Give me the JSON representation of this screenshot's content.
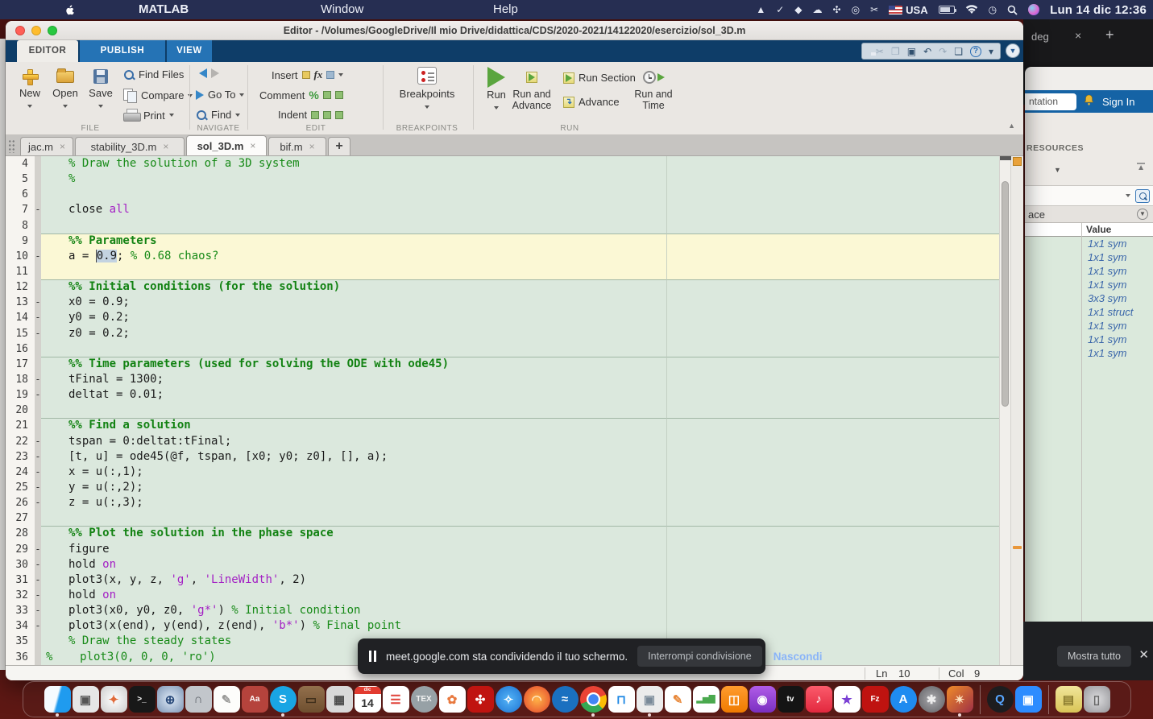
{
  "menubar": {
    "app": "MATLAB",
    "window": "Window",
    "help": "Help",
    "clock": "Lun 14 dic 12:36",
    "flag_label": "USA",
    "status_icons": [
      {
        "name": "shape-app-icon",
        "type": "glyph",
        "glyph": "▲"
      },
      {
        "name": "checkmark-app-icon",
        "type": "glyph",
        "glyph": "✓"
      },
      {
        "name": "dropbox-icon",
        "type": "glyph",
        "glyph": "◆"
      },
      {
        "name": "cloud-upload-icon",
        "type": "glyph",
        "glyph": "☁"
      },
      {
        "name": "fan-app-icon",
        "type": "glyph",
        "glyph": "✣"
      },
      {
        "name": "screen-record-icon",
        "type": "glyph",
        "glyph": "◎"
      },
      {
        "name": "scissors-icon",
        "type": "glyph",
        "glyph": "✂"
      },
      {
        "name": "flag-usa-icon",
        "type": "flag"
      },
      {
        "name": "battery-icon",
        "type": "battery"
      },
      {
        "name": "wifi-icon",
        "type": "wifi"
      },
      {
        "name": "time-machine-icon",
        "type": "glyph",
        "glyph": "◷"
      },
      {
        "name": "spotlight-icon",
        "type": "search"
      },
      {
        "name": "siri-icon",
        "type": "siri"
      }
    ]
  },
  "win": {
    "title": "Editor - /Volumes/GoogleDrive/Il mio Drive/didattica/CDS/2020-2021/14122020/esercizio/sol_3D.m"
  },
  "qat": [
    {
      "name": "save-icon",
      "kind": "floppy"
    },
    {
      "name": "cut-icon",
      "glyph": "✂",
      "disabled": true
    },
    {
      "name": "copy-icon",
      "glyph": "❐",
      "disabled": true
    },
    {
      "name": "paste-icon",
      "glyph": "▣"
    },
    {
      "name": "undo-icon",
      "glyph": "↶"
    },
    {
      "name": "redo-icon",
      "glyph": "↷",
      "disabled": true
    },
    {
      "name": "switch-window-icon",
      "glyph": "❏"
    },
    {
      "name": "help-icon",
      "kind": "help",
      "glyph": "?"
    },
    {
      "name": "more-commands-icon",
      "glyph": "▾"
    }
  ],
  "ribbon": {
    "tabs": [
      "EDITOR",
      "PUBLISH",
      "VIEW"
    ],
    "file": {
      "group": "FILE",
      "new": "New",
      "open": "Open",
      "save": "Save",
      "find_files": "Find Files",
      "compare": "Compare",
      "print": "Print"
    },
    "navigate": {
      "group": "NAVIGATE",
      "goto": "Go To",
      "find": "Find"
    },
    "edit": {
      "group": "EDIT",
      "insert": "Insert",
      "comment": "Comment",
      "indent": "Indent"
    },
    "breakpoints": {
      "group": "BREAKPOINTS",
      "button": "Breakpoints"
    },
    "run": {
      "group": "RUN",
      "run": "Run",
      "run_advance": "Run and Advance",
      "run_section": "Run Section",
      "advance": "Advance",
      "run_time": "Run and Time"
    }
  },
  "file_tabs": {
    "close_glyph": "×",
    "new_tab": "+",
    "tabs": [
      {
        "label": "jac.m",
        "active": false
      },
      {
        "label": "stability_3D.m",
        "active": false
      },
      {
        "label": "sol_3D.m",
        "active": true
      },
      {
        "label": "bif.m",
        "active": false
      }
    ]
  },
  "editor": {
    "lines": [
      {
        "n": 4,
        "bg": "g",
        "seg": [
          [
            "c",
            "% Draw the solution of a 3D system"
          ]
        ]
      },
      {
        "n": 5,
        "bg": "g",
        "seg": [
          [
            "c",
            "%"
          ]
        ]
      },
      {
        "n": 6,
        "bg": "g",
        "seg": []
      },
      {
        "n": 7,
        "bg": "g",
        "d": true,
        "seg": [
          [
            "t",
            "close "
          ],
          [
            "p",
            "all"
          ]
        ]
      },
      {
        "n": 8,
        "bg": "g",
        "seg": []
      },
      {
        "n": 9,
        "bg": "y",
        "div": true,
        "seg": [
          [
            "s",
            "%% Parameters"
          ]
        ]
      },
      {
        "n": 10,
        "bg": "y",
        "d": true,
        "seg": [
          [
            "t",
            "a = "
          ],
          [
            "x",
            "0.9"
          ],
          [
            "t",
            "; "
          ],
          [
            "c",
            "% 0.68 chaos?"
          ]
        ]
      },
      {
        "n": 11,
        "bg": "y",
        "seg": []
      },
      {
        "n": 12,
        "bg": "g",
        "div": true,
        "seg": [
          [
            "s",
            "%% Initial conditions (for the solution)"
          ]
        ]
      },
      {
        "n": 13,
        "bg": "g",
        "d": true,
        "seg": [
          [
            "t",
            "x0 = 0.9;"
          ]
        ]
      },
      {
        "n": 14,
        "bg": "g",
        "d": true,
        "seg": [
          [
            "t",
            "y0 = 0.2;"
          ]
        ]
      },
      {
        "n": 15,
        "bg": "g",
        "d": true,
        "seg": [
          [
            "t",
            "z0 = 0.2;"
          ]
        ]
      },
      {
        "n": 16,
        "bg": "g",
        "seg": []
      },
      {
        "n": 17,
        "bg": "g",
        "div": true,
        "seg": [
          [
            "s",
            "%% Time parameters (used for solving the ODE with ode45)"
          ]
        ]
      },
      {
        "n": 18,
        "bg": "g",
        "d": true,
        "seg": [
          [
            "t",
            "tFinal = 1300;"
          ]
        ]
      },
      {
        "n": 19,
        "bg": "g",
        "d": true,
        "seg": [
          [
            "t",
            "deltat = 0.01;"
          ]
        ]
      },
      {
        "n": 20,
        "bg": "g",
        "seg": []
      },
      {
        "n": 21,
        "bg": "g",
        "div": true,
        "seg": [
          [
            "s",
            "%% Find a solution"
          ]
        ]
      },
      {
        "n": 22,
        "bg": "g",
        "d": true,
        "seg": [
          [
            "t",
            "tspan = 0:deltat:tFinal;"
          ]
        ]
      },
      {
        "n": 23,
        "bg": "g",
        "d": true,
        "seg": [
          [
            "t",
            "[t, u] = ode45(@f, tspan, [x0; y0; z0], [], a);"
          ]
        ]
      },
      {
        "n": 24,
        "bg": "g",
        "d": true,
        "seg": [
          [
            "t",
            "x = u(:,1);"
          ]
        ]
      },
      {
        "n": 25,
        "bg": "g",
        "d": true,
        "seg": [
          [
            "t",
            "y = u(:,2);"
          ]
        ]
      },
      {
        "n": 26,
        "bg": "g",
        "d": true,
        "seg": [
          [
            "t",
            "z = u(:,3);"
          ]
        ]
      },
      {
        "n": 27,
        "bg": "g",
        "seg": []
      },
      {
        "n": 28,
        "bg": "g",
        "div": true,
        "seg": [
          [
            "s",
            "%% Plot the solution in the phase space"
          ]
        ]
      },
      {
        "n": 29,
        "bg": "g",
        "d": true,
        "seg": [
          [
            "t",
            "figure"
          ]
        ]
      },
      {
        "n": 30,
        "bg": "g",
        "d": true,
        "seg": [
          [
            "t",
            "hold "
          ],
          [
            "p",
            "on"
          ]
        ]
      },
      {
        "n": 31,
        "bg": "g",
        "d": true,
        "seg": [
          [
            "t",
            "plot3(x, y, z, "
          ],
          [
            "p",
            "'g'"
          ],
          [
            "t",
            ", "
          ],
          [
            "p",
            "'LineWidth'"
          ],
          [
            "t",
            ", 2)"
          ]
        ]
      },
      {
        "n": 32,
        "bg": "g",
        "d": true,
        "seg": [
          [
            "t",
            "hold "
          ],
          [
            "p",
            "on"
          ]
        ]
      },
      {
        "n": 33,
        "bg": "g",
        "d": true,
        "seg": [
          [
            "t",
            "plot3(x0, y0, z0, "
          ],
          [
            "p",
            "'g*'"
          ],
          [
            "t",
            ") "
          ],
          [
            "c",
            "% Initial condition"
          ]
        ]
      },
      {
        "n": 34,
        "bg": "g",
        "d": true,
        "seg": [
          [
            "t",
            "plot3(x(end), y(end), z(end), "
          ],
          [
            "p",
            "'b*'"
          ],
          [
            "t",
            ") "
          ],
          [
            "c",
            "% Final point"
          ]
        ]
      },
      {
        "n": 35,
        "bg": "g",
        "seg": [
          [
            "c",
            "% Draw the steady states"
          ]
        ]
      },
      {
        "n": 36,
        "bg": "g",
        "ind": 6,
        "seg": [
          [
            "c",
            "%    plot3(0, 0, 0, 'ro')"
          ]
        ]
      }
    ]
  },
  "statusbar": {
    "ln_label": "Ln",
    "ln_value": "10",
    "col_label": "Col",
    "col_value": "9"
  },
  "rightpanel": {
    "browser_tab": "deg",
    "browser_close": "×",
    "browser_new": "+",
    "search_value": "ntation",
    "sign_in": "Sign In",
    "resources": "RESOURCES",
    "workspace_title": "ace",
    "value_header": "Value",
    "values": [
      "1x1 sym",
      "1x1 sym",
      "1x1 sym",
      "1x1 sym",
      "3x3 sym",
      "1x1 struct",
      "1x1 sym",
      "1x1 sym",
      "1x1 sym"
    ]
  },
  "meet": {
    "message": "meet.google.com sta condividendo il tuo schermo.",
    "stop_button": "Interrompi condivisione",
    "hide_button": "Nascondi",
    "show_all_button": "Mostra tutto",
    "close_glyph": "✕"
  },
  "dock": {
    "items": [
      {
        "name": "finder",
        "bg": "linear-gradient(105deg,#f5fbff 46%,#1f9bef 54%)",
        "glyph": "",
        "running": true
      },
      {
        "name": "screenshot",
        "bg": "#e6e6e6",
        "glyph": "▣",
        "color": "#555"
      },
      {
        "name": "launchpad",
        "bg": "radial-gradient(circle,#ffffff,#cccccc)",
        "glyph": "✦",
        "color": "#e06a3a"
      },
      {
        "name": "terminal",
        "bg": "#181818",
        "glyph": ">_",
        "color": "#ffffff",
        "small": true
      },
      {
        "name": "html-editor",
        "bg": "radial-gradient(circle,#dfeaf7,#7d95b5)",
        "glyph": "⊕",
        "color": "#2a4a7a"
      },
      {
        "name": "archive-utility",
        "bg": "#c2c6cb",
        "glyph": "∩",
        "color": "#5a5f66"
      },
      {
        "name": "textedit",
        "bg": "#fdfdfb",
        "glyph": "✎",
        "color": "#9a9a98"
      },
      {
        "name": "dictionary",
        "bg": "#b5433c",
        "glyph": "Aa",
        "color": "#ffffff",
        "small": true
      },
      {
        "name": "skype",
        "bg": "#19a5e4",
        "glyph": "S",
        "color": "#ffffff",
        "shape": "circle",
        "running": true
      },
      {
        "name": "photo-booth",
        "bg": "linear-gradient(#93704c,#6e4f2f)",
        "glyph": "▭",
        "color": "#41301c"
      },
      {
        "name": "calculator",
        "bg": "#d9d9d9",
        "glyph": "▦",
        "color": "#4a4a4a"
      },
      {
        "name": "calendar",
        "type": "cal",
        "top": "dic",
        "day": "14"
      },
      {
        "name": "reminders",
        "bg": "#ffffff",
        "glyph": "☰",
        "color": "#e0443a"
      },
      {
        "name": "texshop",
        "bg": "#97a1a6",
        "glyph": "TEX",
        "color": "#f2f2f2",
        "shape": "circle",
        "small": true
      },
      {
        "name": "photos",
        "bg": "#ffffff",
        "glyph": "✿",
        "color": "#e8793f"
      },
      {
        "name": "acrobat",
        "bg": "#c01410",
        "glyph": "✣",
        "color": "#ffffff"
      },
      {
        "name": "safari",
        "bg": "radial-gradient(circle,#55b5f7,#1c72d2)",
        "glyph": "✧",
        "color": "#ffffff",
        "shape": "circle"
      },
      {
        "name": "firefox",
        "bg": "radial-gradient(circle,#ffb347,#e3432c)",
        "glyph": "◠",
        "color": "#ffe9c2",
        "shape": "circle"
      },
      {
        "name": "openoffice",
        "bg": "#1a70c0",
        "glyph": "≈",
        "color": "#ffffff",
        "shape": "circle"
      },
      {
        "name": "chrome",
        "type": "chrome",
        "running": true
      },
      {
        "name": "keynote",
        "bg": "#ffffff",
        "glyph": "⊓",
        "color": "#1d87e4"
      },
      {
        "name": "image-capture",
        "bg": "#ececec",
        "glyph": "▣",
        "color": "#7a8a99",
        "running": true
      },
      {
        "name": "pages",
        "bg": "#ffffff",
        "glyph": "✎",
        "color": "#e8883a"
      },
      {
        "name": "numbers",
        "bg": "#ffffff",
        "glyph": "▂▅▇",
        "color": "#4aa94e",
        "small": true
      },
      {
        "name": "books",
        "bg": "linear-gradient(#ff9c2e,#ef7b00)",
        "glyph": "◫",
        "color": "#ffffff"
      },
      {
        "name": "podcasts",
        "bg": "linear-gradient(#b05ce8,#7a2fc0)",
        "glyph": "◉",
        "color": "#ffffff"
      },
      {
        "name": "apple-tv",
        "bg": "#141414",
        "glyph": "tv",
        "color": "#ffffff",
        "small": true
      },
      {
        "name": "music",
        "bg": "linear-gradient(#fb5b6b,#e2283e)",
        "glyph": "♪",
        "color": "#ffffff"
      },
      {
        "name": "imovie",
        "bg": "#ffffff",
        "glyph": "★",
        "color": "#7a3fd4"
      },
      {
        "name": "filezilla",
        "bg": "#bf1310",
        "glyph": "Fz",
        "color": "#ffffff",
        "small": true
      },
      {
        "name": "app-store",
        "bg": "#1f8bf0",
        "glyph": "A",
        "color": "#ffffff",
        "shape": "circle"
      },
      {
        "name": "system-preferences",
        "bg": "radial-gradient(circle,#a8a8ac,#5f5f63)",
        "glyph": "✱",
        "color": "#ededed",
        "shape": "circle"
      },
      {
        "name": "matlab",
        "bg": "linear-gradient(135deg,#f08c28,#9e2f46)",
        "glyph": "✴",
        "color": "#ffe2bd",
        "running": true
      },
      {
        "type": "sep"
      },
      {
        "name": "quicktime",
        "bg": "#1d1d1f",
        "glyph": "Q",
        "color": "#58a6ff",
        "shape": "circle"
      },
      {
        "name": "zoom-app",
        "bg": "#2d8cff",
        "glyph": "▣",
        "color": "#ffffff"
      },
      {
        "type": "sep"
      },
      {
        "name": "downloads-stack",
        "bg": "linear-gradient(#f0e59a,#d9c557)",
        "glyph": "▤",
        "color": "#8a7b2e"
      },
      {
        "name": "trash",
        "bg": "radial-gradient(circle,#dcdcde,#97979b)",
        "glyph": "▯",
        "color": "#666666"
      }
    ]
  }
}
